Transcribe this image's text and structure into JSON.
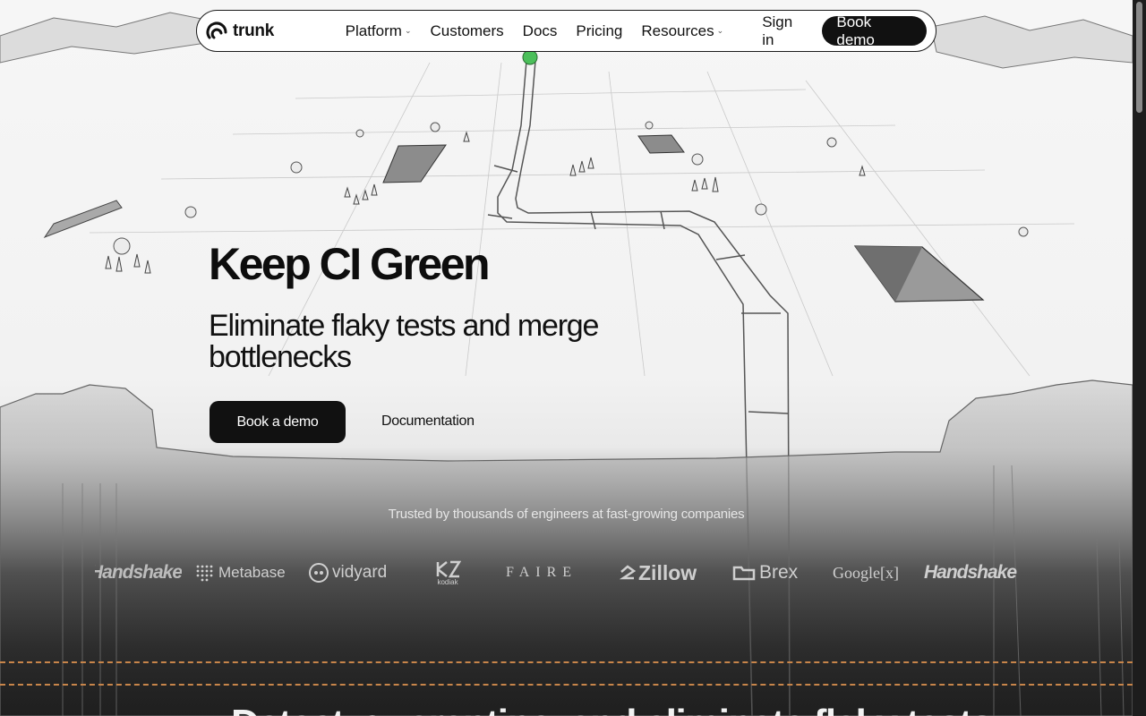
{
  "nav": {
    "logo_text": "trunk",
    "links": [
      {
        "label": "Platform",
        "has_dropdown": true
      },
      {
        "label": "Customers",
        "has_dropdown": false
      },
      {
        "label": "Docs",
        "has_dropdown": false
      },
      {
        "label": "Pricing",
        "has_dropdown": false
      },
      {
        "label": "Resources",
        "has_dropdown": true
      }
    ],
    "sign_in": "Sign in",
    "book_demo": "Book demo"
  },
  "hero": {
    "title": "Keep CI Green",
    "subtitle": "Eliminate flaky tests and merge bottlenecks",
    "primary_button": "Book a demo",
    "secondary_button": "Documentation"
  },
  "trusted": {
    "text": "Trusted by thousands of engineers at fast-growing companies",
    "companies": [
      "Handshake",
      "Metabase",
      "vidyard",
      "kodiak",
      "FAIRE",
      "Zillow",
      "Brex",
      "Google[x]",
      "Handshake"
    ]
  },
  "next_section": {
    "heading_partial": "Detect, quarantine, and eliminate flaky tests"
  },
  "colors": {
    "accent_dashes": "#c8854a",
    "pipe_green": "#4bbf5a",
    "dark": "#111111"
  }
}
